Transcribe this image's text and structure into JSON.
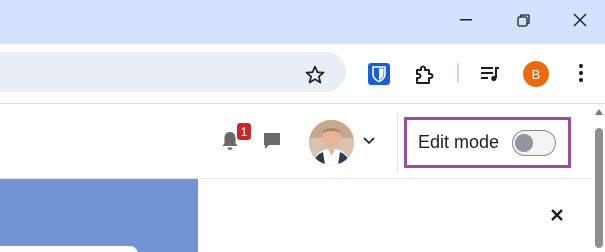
{
  "window": {
    "minimize_icon": "minimize-icon",
    "restore_icon": "restore-icon",
    "close_icon": "close-icon"
  },
  "toolbar": {
    "bookmark_icon": "star-icon",
    "extensions": [
      {
        "name": "bitwarden-icon"
      },
      {
        "name": "puzzle-icon"
      },
      {
        "name": "media-control-icon"
      }
    ],
    "profile_initial": "B",
    "menu_icon": "kebab-icon",
    "profile_color": "#ea6b0f"
  },
  "header": {
    "notification_count": "1",
    "edit_mode_label": "Edit mode",
    "edit_mode_on": false,
    "accent_border_color": "#9b4e9f"
  },
  "banner": {
    "color": "#7294d4",
    "close_icon": "close-icon"
  }
}
